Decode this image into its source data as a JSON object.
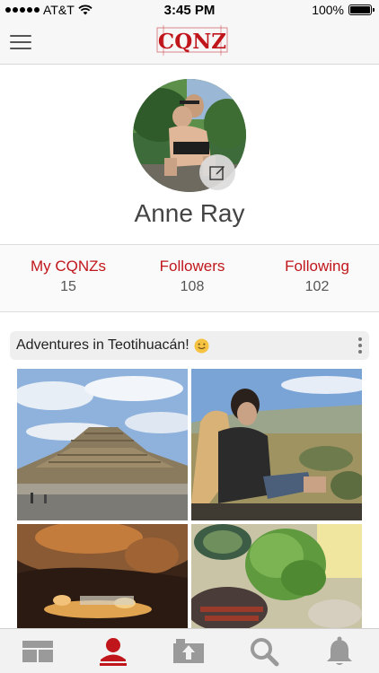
{
  "status_bar": {
    "carrier": "AT&T",
    "time": "3:45 PM",
    "battery": "100%",
    "battery_level": 1.0
  },
  "nav": {
    "logo_text": "CQNZ",
    "menu_icon": "hamburger-menu-icon"
  },
  "profile": {
    "name": "Anne Ray",
    "edit_icon": "edit-icon"
  },
  "stats": [
    {
      "label": "My CQNZs",
      "value": "15"
    },
    {
      "label": "Followers",
      "value": "108"
    },
    {
      "label": "Following",
      "value": "102"
    }
  ],
  "post": {
    "title": "Adventures in Teotihuacán!",
    "emoji_icon": "smiley-emoji-icon",
    "more_icon": "more-vertical-icon",
    "photos": [
      {
        "name": "pyramid-photo"
      },
      {
        "name": "couple-view-photo"
      },
      {
        "name": "cave-photo"
      },
      {
        "name": "food-photo"
      }
    ]
  },
  "tab_bar": {
    "items": [
      {
        "icon": "feed-grid-icon",
        "active": false
      },
      {
        "icon": "profile-icon",
        "active": true
      },
      {
        "icon": "upload-photo-icon",
        "active": false
      },
      {
        "icon": "search-icon",
        "active": false
      },
      {
        "icon": "bell-icon",
        "active": false
      }
    ]
  },
  "colors": {
    "accent": "#c0161b",
    "icon_inactive": "#9a9a9a"
  }
}
